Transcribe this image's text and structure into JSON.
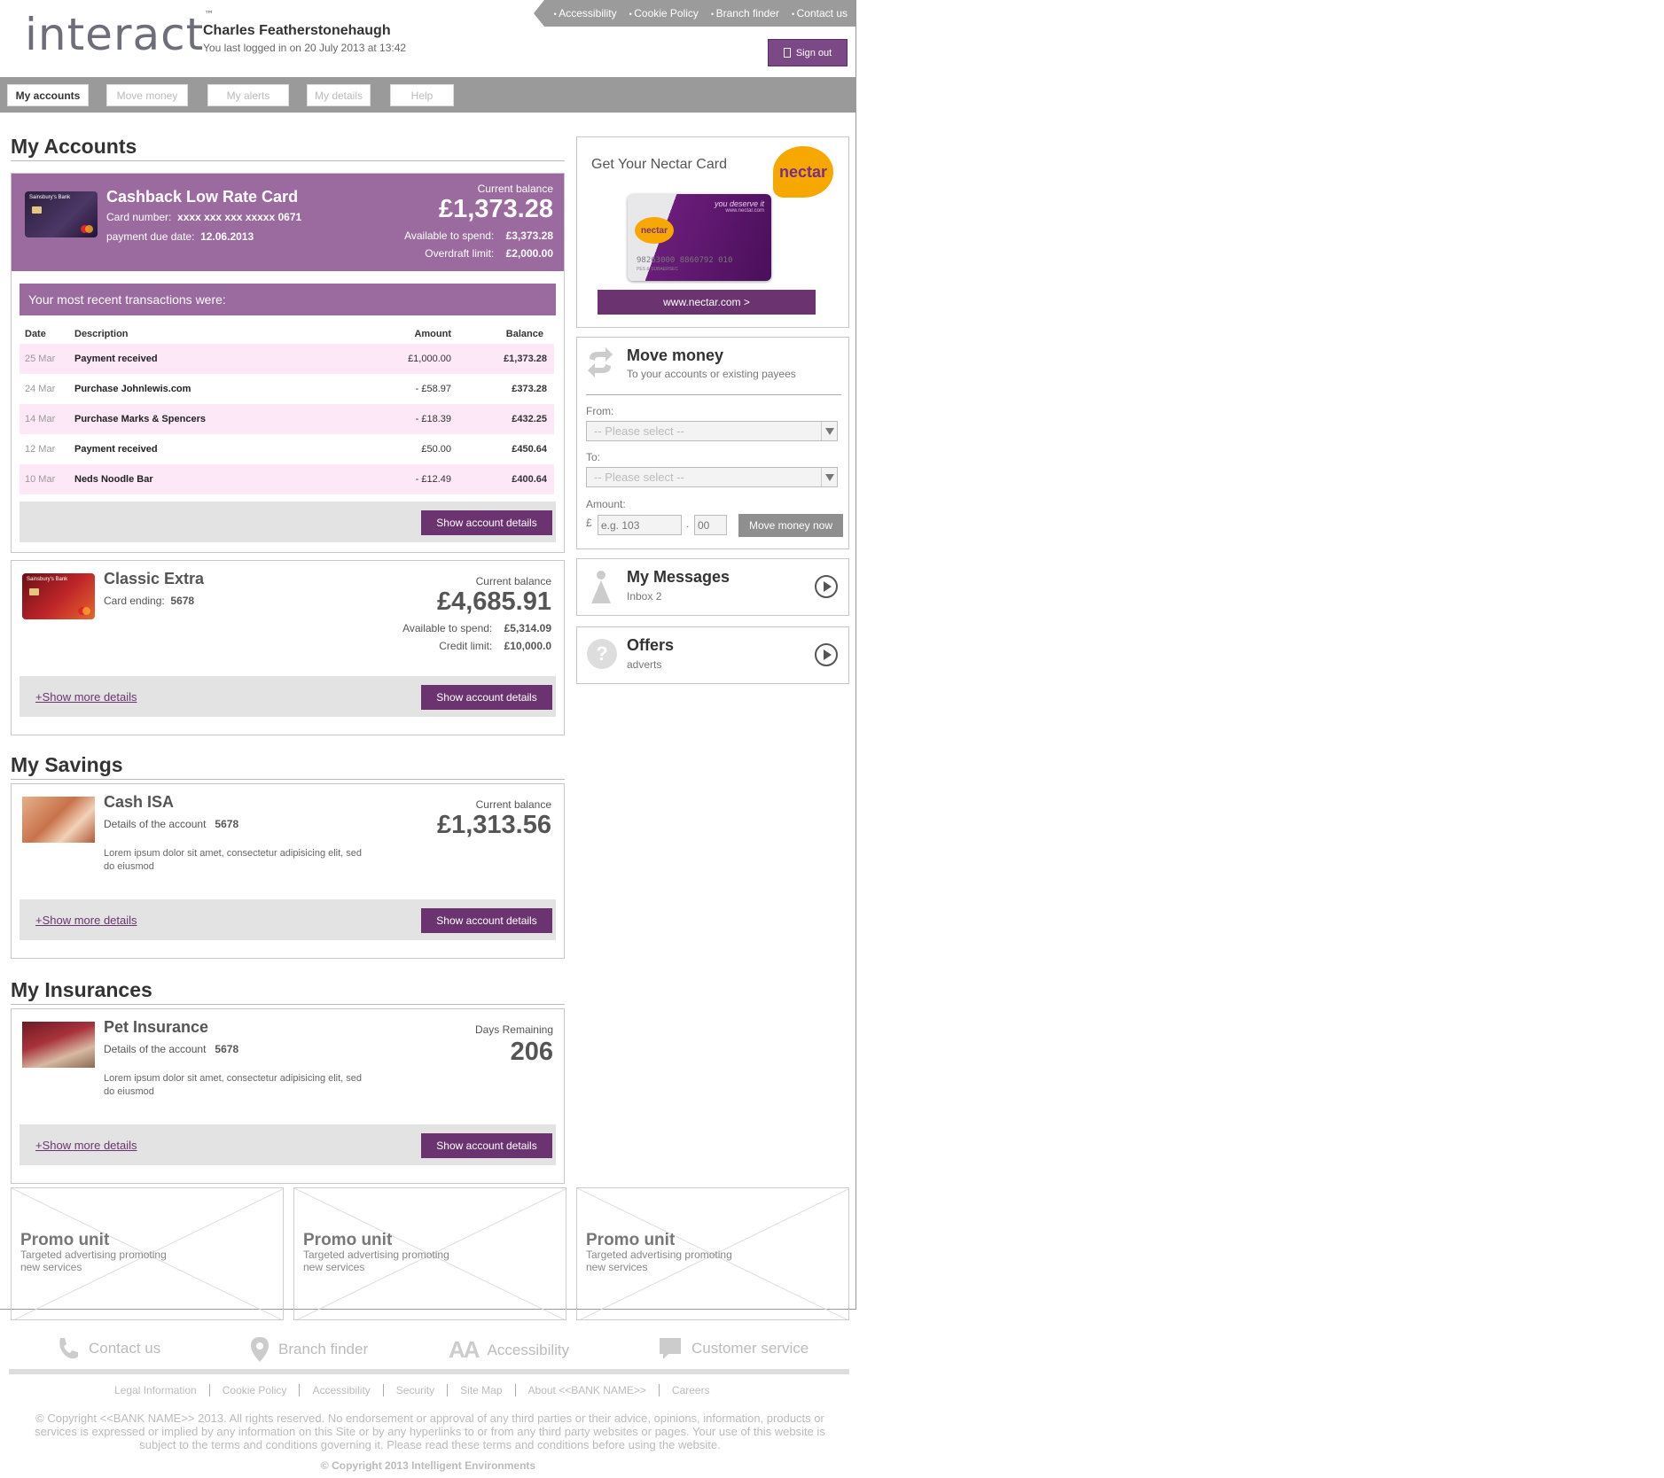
{
  "header": {
    "logo_text": "interact",
    "logo_tm": "™",
    "user_name": "Charles Featherstonehaugh",
    "last_login": "You last logged in on 20 July 2013 at 13:42",
    "utility_links": [
      "Accessibility",
      "Cookie Policy",
      "Branch finder",
      "Contact us"
    ],
    "sign_out": "Sign out"
  },
  "nav": {
    "tabs": [
      "My accounts",
      "Move money",
      "My alerts",
      "My details",
      "Help"
    ],
    "active": "My accounts"
  },
  "accounts": {
    "heading": "My Accounts",
    "card1": {
      "brand": "Sainsbury's Bank",
      "name": "Cashback Low Rate Card",
      "number_label": "Card number:",
      "number": "xxxx xxx xxx xxxxx 0671",
      "due_label": "payment due date:",
      "due": "12.06.2013",
      "balance_label": "Current balance",
      "balance": "£1,373.28",
      "available_label": "Available to spend:",
      "available": "£3,373.28",
      "overdraft_label": "Overdraft limit:",
      "overdraft": "£2,000.00",
      "recent_heading": "Your most recent transactions were:",
      "columns": [
        "Date",
        "Description",
        "Amount",
        "Balance"
      ],
      "transactions": [
        {
          "date": "25 Mar",
          "desc": "Payment received",
          "amount": "£1,000.00",
          "balance": "£1,373.28"
        },
        {
          "date": "24 Mar",
          "desc": "Purchase Johnlewis.com",
          "amount": "- £58.97",
          "balance": "£373.28"
        },
        {
          "date": "14 Mar",
          "desc": "Purchase Marks & Spencers",
          "amount": "- £18.39",
          "balance": "£432.25"
        },
        {
          "date": "12 Mar",
          "desc": "Payment received",
          "amount": "£50.00",
          "balance": "£450.64"
        },
        {
          "date": "10 Mar",
          "desc": "Neds Noodle Bar",
          "amount": "- £12.49",
          "balance": "£400.64"
        }
      ],
      "button": "Show account details"
    },
    "card2": {
      "brand": "Sainsbury's Bank",
      "name": "Classic Extra",
      "ending_label": "Card ending:",
      "ending": "5678",
      "balance_label": "Current balance",
      "balance": "£4,685.91",
      "available_label": "Available to spend:",
      "available": "£5,314.09",
      "credit_label": "Credit limit:",
      "credit": "£10,000.0",
      "more": "+Show more details",
      "button": "Show account details"
    }
  },
  "savings": {
    "heading": "My Savings",
    "name": "Cash ISA",
    "details_label": "Details of the account",
    "details": "5678",
    "lorem": "Lorem ipsum dolor sit amet, consectetur adipisicing elit, sed do eiusmod",
    "balance_label": "Current balance",
    "balance": "£1,313.56",
    "more": "+Show more details",
    "button": "Show account details"
  },
  "insurances": {
    "heading": "My Insurances",
    "name": "Pet Insurance",
    "details_label": "Details of the account",
    "details": "5678",
    "lorem": "Lorem ipsum dolor sit amet, consectetur adipisicing elit, sed do eiusmod",
    "days_label": "Days Remaining",
    "days": "206",
    "more": "+Show more details",
    "button": "Show account details"
  },
  "nectar": {
    "title": "Get Your Nectar Card",
    "logo": "nectar",
    "card_tagline": "you deserve it",
    "card_site": "www.nectar.com",
    "card_number": "98263000 8860792 010",
    "card_sub": "PES & SUBAERSEC",
    "link": "www.nectar.com >"
  },
  "move_money": {
    "title": "Move money",
    "subtitle": "To your accounts or existing payees",
    "from_label": "From:",
    "from_placeholder": "-- Please select --",
    "to_label": "To:",
    "to_placeholder": "-- Please select --",
    "amount_label": "Amount:",
    "currency": "£",
    "amount_placeholder": "e.g. 103",
    "pence_placeholder": "00",
    "separator": ".",
    "button": "Move money now"
  },
  "messages": {
    "title": "My Messages",
    "subtitle": "Inbox 2"
  },
  "offers": {
    "title": "Offers",
    "subtitle": "adverts"
  },
  "promos": [
    {
      "title": "Promo unit",
      "text": "Targeted advertising promoting new services"
    },
    {
      "title": "Promo unit",
      "text": "Targeted advertising promoting new services"
    },
    {
      "title": "Promo unit",
      "text": "Targeted advertising promoting new services"
    }
  ],
  "footer": {
    "quick_links": [
      {
        "label": "Contact us",
        "icon": "phone-icon"
      },
      {
        "label": "Branch finder",
        "icon": "map-pin-icon"
      },
      {
        "label": "Accessibility",
        "icon": "text-size-icon"
      },
      {
        "label": "Customer service",
        "icon": "speech-bubble-icon"
      }
    ],
    "links": [
      "Legal Information",
      "Cookie Policy",
      "Accessibility",
      "Security",
      "Site Map",
      "About <<BANK NAME>>",
      "Careers"
    ],
    "disclaimer": "© Copyright <<BANK NAME>> 2013. All rights reserved. No endorsement or approval of any third parties or their advice, opinions, information, products or services is expressed or implied by any information on this Site or by any hyperlinks to or from any third party websites or pages. Your use of this website is subject to the terms and conditions governing it. Please read these terms and conditions before using the website.",
    "copyright": "© Copyright 2013 Intelligent Environments"
  },
  "colors": {
    "brand_purple": "#9b6a9f",
    "button_purple": "#6b3470",
    "row_pink": "#fce8f7",
    "nav_grey": "#9a9a9a"
  }
}
